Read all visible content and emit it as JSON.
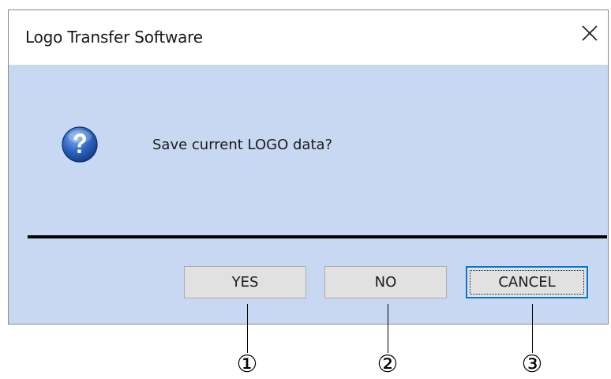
{
  "dialog": {
    "title": "Logo Transfer Software",
    "close_icon": "close-icon",
    "question_icon": "question-icon",
    "message": "Save current LOGO data?",
    "buttons": {
      "yes": "YES",
      "no": "NO",
      "cancel": "CANCEL"
    },
    "focused_button": "cancel"
  },
  "callouts": [
    "①",
    "②",
    "③"
  ],
  "colors": {
    "client_background": "#c9d8f2",
    "button_face": "#e1e1e1",
    "focus_border": "#0078d7",
    "icon_blue": "#2a62b8"
  }
}
